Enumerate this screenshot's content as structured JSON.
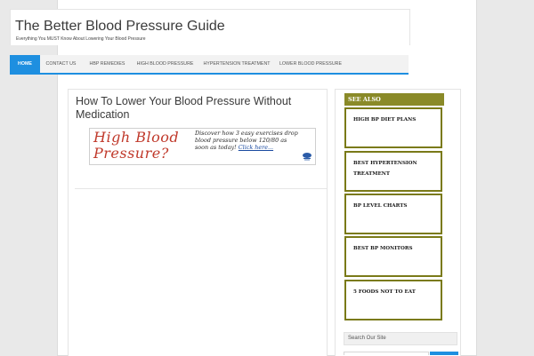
{
  "header": {
    "title": "The Better Blood Pressure Guide",
    "tagline": "Everything You MUST Know About Lowering Your Blood Pressure"
  },
  "nav": {
    "items": [
      "HOME",
      "CONTACT US",
      "HBP REMEDIES",
      "HIGH BLOOD PRESSURE",
      "HYPERTENSION TREATMENT",
      "LOWER BLOOD PRESSURE"
    ]
  },
  "post": {
    "title": "How To Lower Your Blood Pressure Without Medication",
    "banner": {
      "headline": "High Blood Pressure?",
      "copy": "Discover how 3 easy exercises drop blood pressure below 120/80 as soon as today!",
      "link": "Click here..."
    }
  },
  "sidebar": {
    "see_also_title": "SEE ALSO",
    "cards": [
      "HIGH BP DIET PLANS",
      "BEST HYPERTENSION TREATMENT",
      "BP LEVEL CHARTS",
      "BEST BP MONITORS",
      "5 FOODS NOT TO EAT"
    ],
    "search_title": "Search Our Site"
  },
  "colors": {
    "nav_active": "#1e8fe0",
    "see_also_olive": "#8a8a28",
    "banner_red": "#c0392b"
  }
}
